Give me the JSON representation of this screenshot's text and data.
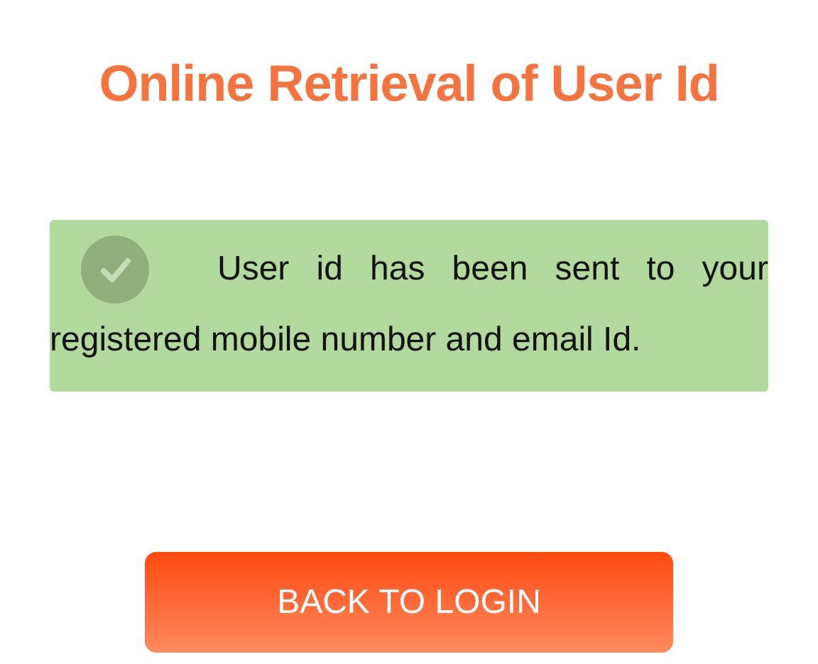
{
  "title": "Online Retrieval of User Id",
  "message": {
    "kind": "success",
    "text": "User id has been sent to your registered mobile number and email Id."
  },
  "button": "BACK TO LOGIN"
}
